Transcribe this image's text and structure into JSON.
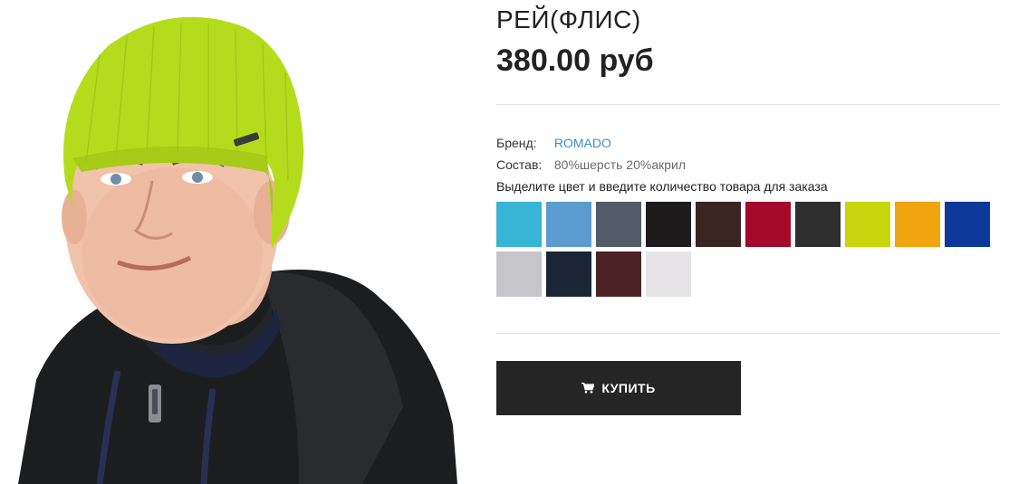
{
  "product": {
    "title": "РЕЙ(ФЛИС)",
    "price": "380.00 руб",
    "image_alt": "young man wearing lime green knit beanie"
  },
  "attributes": {
    "brand_label": "Бренд:",
    "brand_value": "ROMADO",
    "composition_label": "Состав:",
    "composition_value": "80%шерсть 20%акрил"
  },
  "color_instruction": "Выделите цвет и введите количество товара для заказа",
  "swatches": [
    {
      "name": "turquoise",
      "color": "#38b4d4"
    },
    {
      "name": "sky-blue",
      "color": "#5b9bd0"
    },
    {
      "name": "slate-gray",
      "color": "#525b68"
    },
    {
      "name": "black",
      "color": "#1d1b1b"
    },
    {
      "name": "dark-brown",
      "color": "#3a2522"
    },
    {
      "name": "burgundy",
      "color": "#a3092a"
    },
    {
      "name": "charcoal",
      "color": "#2f2f30"
    },
    {
      "name": "lime",
      "color": "#c7d50c"
    },
    {
      "name": "amber",
      "color": "#f0a50f"
    },
    {
      "name": "royal-blue",
      "color": "#0d3a9a"
    },
    {
      "name": "light-gray",
      "color": "#c5c5ca"
    },
    {
      "name": "navy",
      "color": "#1a2634"
    },
    {
      "name": "maroon",
      "color": "#4d2226"
    },
    {
      "name": "off-white",
      "color": "#e6e4e6"
    }
  ],
  "buy_button": {
    "label": "КУПИТЬ",
    "icon": "cart-icon"
  },
  "colors": {
    "button_bg": "#252525",
    "link": "#3b8fd0",
    "hat": "#b5dc1c"
  }
}
